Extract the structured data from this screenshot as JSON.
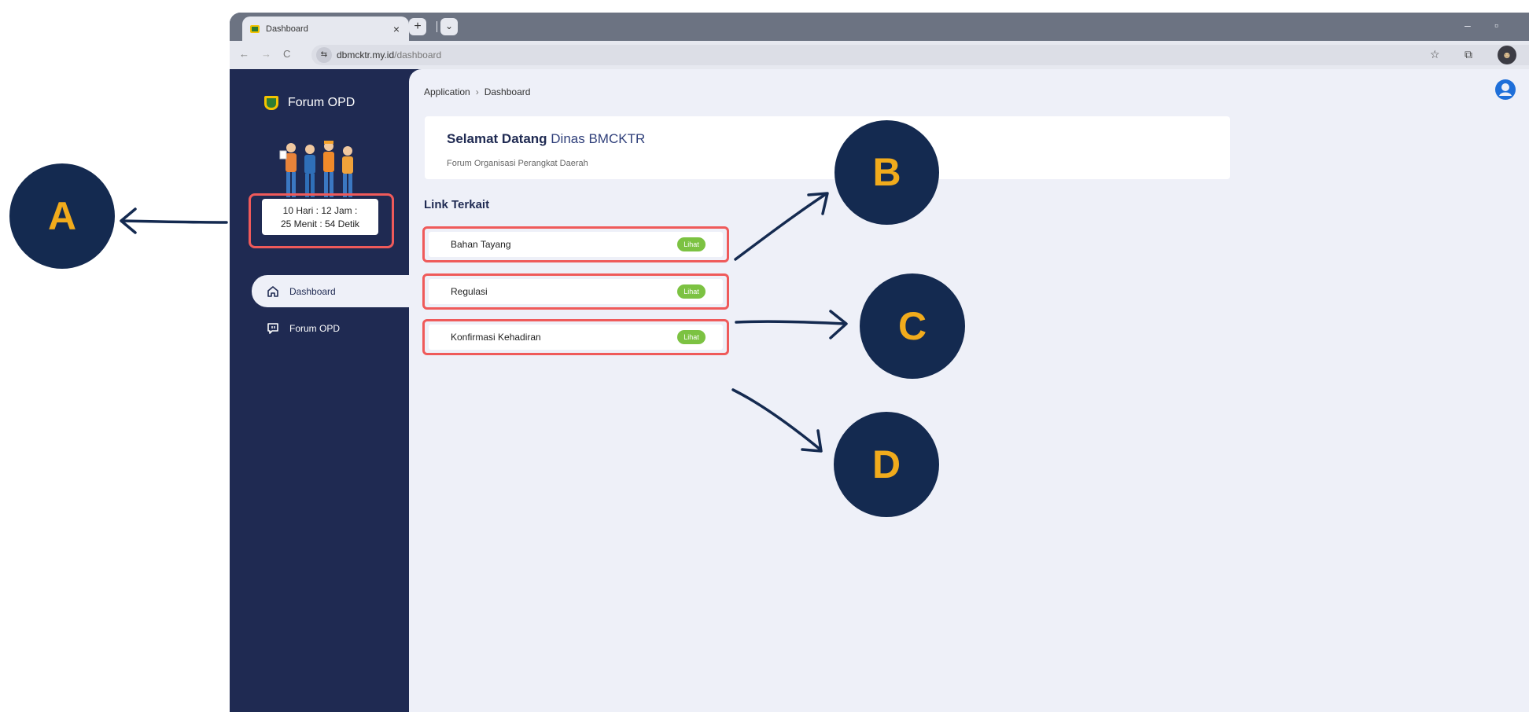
{
  "browser": {
    "tab_title": "Dashboard",
    "tab_close": "×",
    "new_tab": "+",
    "tab_menu": "⌄",
    "url_domain": "dbmcktr.my.id",
    "url_path": "/dashboard",
    "back": "←",
    "forward": "→",
    "reload": "C",
    "site_info": "⇆",
    "bookmark": "☆",
    "extensions": "⧉",
    "minimize": "–",
    "maximize": "▫"
  },
  "sidebar": {
    "brand": "Forum OPD",
    "countdown_line1": "10 Hari : 12 Jam :",
    "countdown_line2": "25 Menit : 54 Detik",
    "items": [
      {
        "label": "Dashboard",
        "active": true
      },
      {
        "label": "Forum OPD",
        "active": false
      }
    ]
  },
  "main": {
    "breadcrumb_root": "Application",
    "breadcrumb_sep": "›",
    "breadcrumb_current": "Dashboard",
    "welcome_bold": "Selamat Datang",
    "welcome_org": "Dinas BMCKTR",
    "welcome_sub": "Forum Organisasi Perangkat Daerah",
    "section_title": "Link Terkait",
    "links": [
      {
        "label": "Bahan Tayang",
        "action": "Lihat"
      },
      {
        "label": "Regulasi",
        "action": "Lihat"
      },
      {
        "label": "Konfirmasi Kehadiran",
        "action": "Lihat"
      }
    ]
  },
  "annotations": [
    "A",
    "B",
    "C",
    "D"
  ],
  "colors": {
    "sidebar": "#1f2a52",
    "main_bg": "#eef0f8",
    "highlight": "#ef5a5a",
    "badge": "#7cc242",
    "callout_bg": "#142a50",
    "callout_text": "#f1ab1c"
  }
}
